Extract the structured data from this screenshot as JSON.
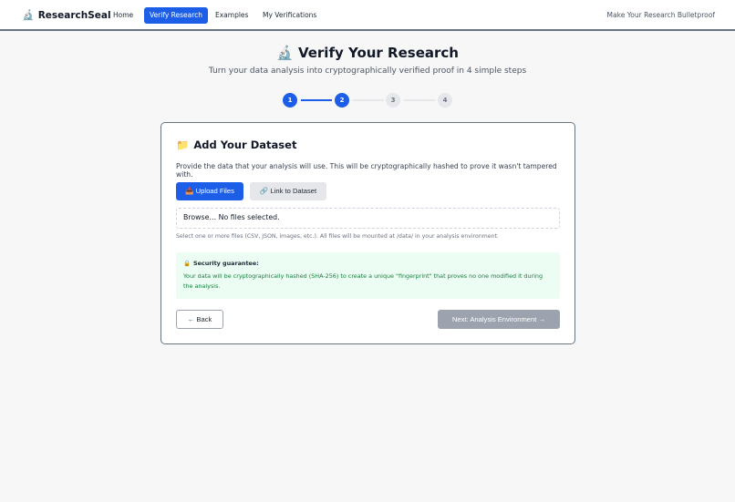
{
  "nav": {
    "brand_icon": "🔬",
    "brand": "ResearchSeal",
    "links": [
      "Home",
      "Verify Research",
      "Examples",
      "My Verifications"
    ],
    "active_link": "Verify Research",
    "tagline": "Make Your Research Bulletproof"
  },
  "header": {
    "title_icon": "🔬",
    "title": "Verify Your Research",
    "subtitle": "Turn your data analysis into cryptographically verified proof in 4 simple steps"
  },
  "stepper": {
    "steps": [
      "1",
      "2",
      "3",
      "4"
    ],
    "current_step": 2
  },
  "card": {
    "title_icon": "📁",
    "title": "Add Your Dataset",
    "description": "Provide the data that your analysis will use. This will be cryptographically hashed to prove it wasn't tampered with.",
    "upload_button": "📥 Upload Files",
    "link_button": "🔗 Link to Dataset",
    "file_input_text": "Browse… No files selected.",
    "file_hint": "Select one or more files (CSV, JSON, images, etc.). All files will be mounted at /data/ in your analysis environment.",
    "guarantee": {
      "icon": "🔒",
      "title": "Security guarantee:",
      "body": "Your data will be cryptographically hashed (SHA-256) to create a unique \"fingerprint\" that proves no one modified it during the analysis."
    },
    "back_button": "← Back",
    "next_button": "Next: Analysis Environment →"
  },
  "colors": {
    "primary": "#1d5ee8",
    "disabled": "#9ca3af",
    "success_bg": "#ecfdf3",
    "success_text": "#15803d"
  }
}
